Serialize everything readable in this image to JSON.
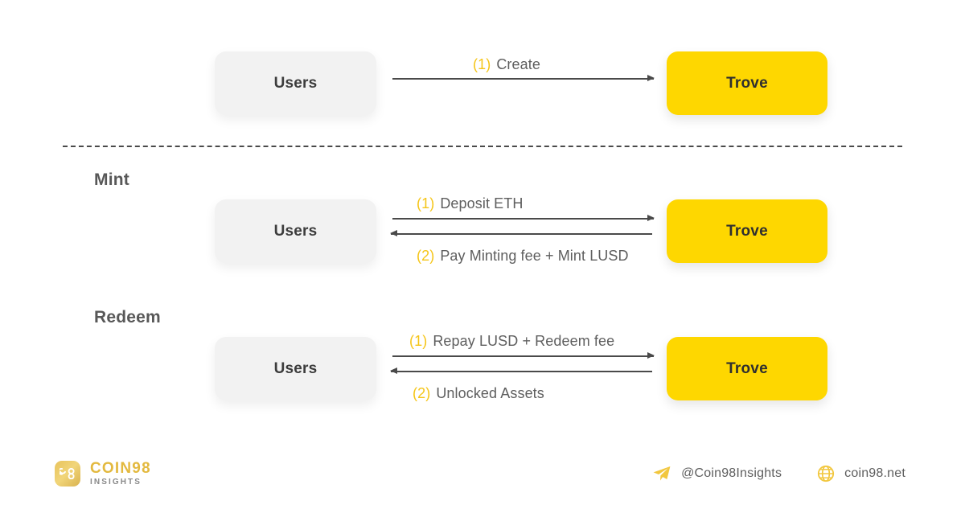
{
  "colors": {
    "accent_yellow": "#FED700",
    "step_gold": "#F5C518",
    "node_gray": "#F2F2F2",
    "text_gray": "#5E5E5E",
    "line_gray": "#4A4A4A",
    "logo_gold": "#E3B93F"
  },
  "sections": [
    {
      "id": "create",
      "title": "",
      "left_node": "Users",
      "right_node": "Trove",
      "flows": [
        {
          "step": "(1)",
          "label": "Create",
          "direction": "right"
        }
      ]
    },
    {
      "id": "mint",
      "title": "Mint",
      "left_node": "Users",
      "right_node": "Trove",
      "flows": [
        {
          "step": "(1)",
          "label": "Deposit ETH",
          "direction": "right"
        },
        {
          "step": "(2)",
          "label": "Pay Minting fee + Mint LUSD",
          "direction": "left"
        }
      ]
    },
    {
      "id": "redeem",
      "title": "Redeem",
      "left_node": "Users",
      "right_node": "Trove",
      "flows": [
        {
          "step": "(1)",
          "label": "Repay LUSD + Redeem fee",
          "direction": "right"
        },
        {
          "step": "(2)",
          "label": "Unlocked Assets",
          "direction": "left"
        }
      ]
    }
  ],
  "footer": {
    "logo": {
      "mark": "98",
      "name": "COIN98",
      "sub": "INSIGHTS"
    },
    "contacts": [
      {
        "icon": "telegram-icon",
        "text": "@Coin98Insights"
      },
      {
        "icon": "globe-icon",
        "text": "coin98.net"
      }
    ]
  }
}
